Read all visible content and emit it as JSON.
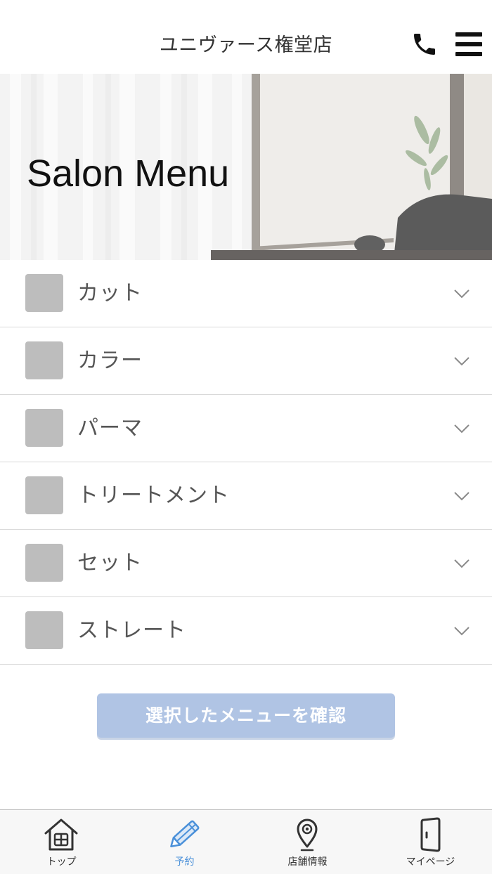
{
  "header": {
    "title": "ユニヴァース権堂店",
    "phone_icon": "phone-icon",
    "menu_icon": "hamburger-menu-icon"
  },
  "hero": {
    "title": "Salon Menu"
  },
  "menu": {
    "expand_icon": "chevron-down-icon",
    "items": [
      {
        "label": "カット",
        "checked": false
      },
      {
        "label": "カラー",
        "checked": false
      },
      {
        "label": "パーマ",
        "checked": false
      },
      {
        "label": "トリートメント",
        "checked": false
      },
      {
        "label": "セット",
        "checked": false
      },
      {
        "label": "ストレート",
        "checked": false
      }
    ]
  },
  "confirm_button": {
    "label": "選択したメニューを確認",
    "enabled": false
  },
  "tabbar": {
    "items": [
      {
        "label": "トップ",
        "icon": "home-icon",
        "active": false
      },
      {
        "label": "予約",
        "icon": "pencil-icon",
        "active": true
      },
      {
        "label": "店舗情報",
        "icon": "map-pin-icon",
        "active": false
      },
      {
        "label": "マイページ",
        "icon": "door-icon",
        "active": false
      }
    ]
  },
  "colors": {
    "accent": "#4a90d9",
    "button_disabled": "#b0c4e4",
    "checkbox": "#bdbdbd",
    "label_text": "#555555"
  }
}
